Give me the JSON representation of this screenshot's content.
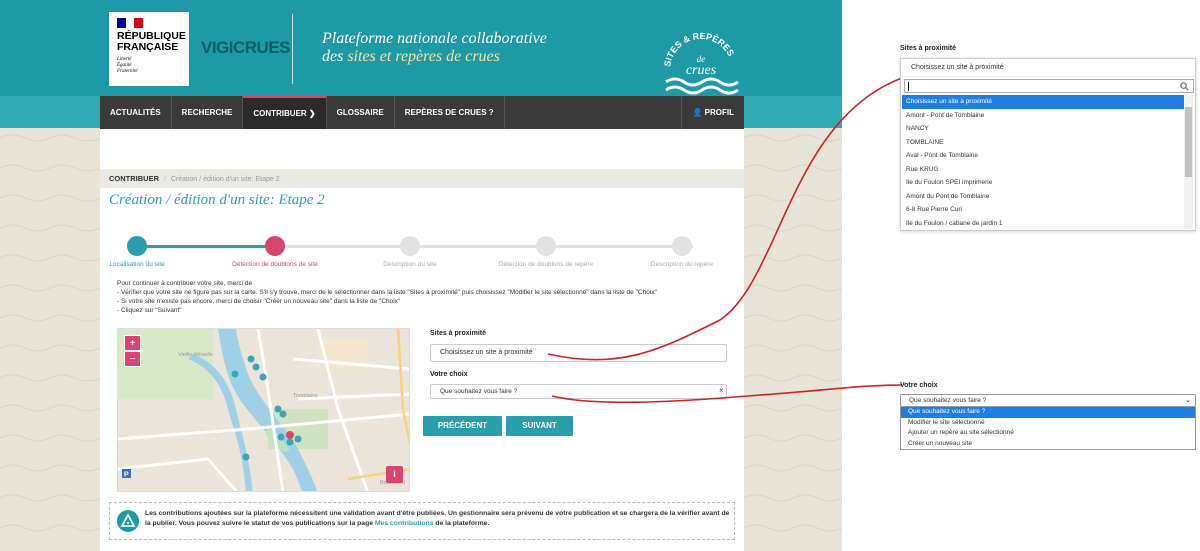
{
  "header": {
    "rf_title": [
      "RÉPUBLIQUE",
      "FRANÇAISE"
    ],
    "rf_motto": [
      "Liberté",
      "Égalité",
      "Fraternité"
    ],
    "vigicrues": "VIGICRUES",
    "platform_title_line1": "Plateforme nationale collaborative",
    "platform_title_line2_prefix": "des ",
    "platform_title_line2_highlight": "sites et repères de crues",
    "logo_text": [
      "SITES & REPÈRES",
      "de",
      "crues"
    ],
    "colors": {
      "teal": "#1d9aa6",
      "pink": "#d8456e",
      "navbar": "#3a3a3a"
    }
  },
  "nav": {
    "items": [
      "ACTUALITÉS",
      "RECHERCHE",
      "CONTRIBUER",
      "GLOSSAIRE",
      "REPÈRES DE CRUES ?"
    ],
    "profile": "PROFIL"
  },
  "breadcrumb": {
    "root": "CONTRIBUER",
    "sep": "/",
    "current": "Création / édition d'un site: Etape 2"
  },
  "page_title": "Création / édition d'un site: Etape 2",
  "stepper": {
    "steps": [
      {
        "label": "Localisation du site",
        "state": "done"
      },
      {
        "label": "Détection de doublons de site",
        "state": "current"
      },
      {
        "label": "Description du site",
        "state": "todo"
      },
      {
        "label": "Détection de doublons de repère",
        "state": "todo"
      },
      {
        "label": "Description du repère",
        "state": "todo"
      }
    ]
  },
  "instructions": [
    "Pour continuer à contribuer votre site, merci de",
    "- Vérifier que votre site ne figure pas sur la carte. S'il s'y trouve, merci de le sélectionner dans la liste \"Sites à proximité\" puis choisissez \"Modifier le site sélectionné\" dans la liste de \"Choix\"",
    "- Si votre site n'existe pas encore, merci de choisir \"Créer un nouveau site\" dans la liste de \"Choix\"",
    "- Cliquez sur \"Suivant\""
  ],
  "map": {
    "zoom_in": "+",
    "zoom_out": "−",
    "info": "i",
    "labels": [
      "Vieille Moselle",
      "Tomblaine",
      "Boulevard"
    ]
  },
  "form": {
    "sites_label": "Sites à proximité",
    "sites_value": "Choisissez un site à proximité",
    "choix_label": "Votre choix",
    "choix_value": "Que souhaitez vous faire ?",
    "clear": "×",
    "prev_button": "PRÉCÉDENT",
    "next_button": "SUIVANT"
  },
  "notice": {
    "text_before": "Les contributions ajoutées sur la plateforme nécessitent une validation avant d'être publiées. Un gestionnaire sera prévenu de votre publication et se chargera de la vérifier avant de la publier. Vous pouvez suivre le statut de vos publications sur la page ",
    "link": "Mes contributions",
    "text_after": " de la plateforme."
  },
  "dropdown_sites": {
    "label": "Sites à proximité",
    "placeholder": "Choisissez un site à proximité",
    "options": [
      "Choisissez un site à proximité",
      "Amont - Pont de Tomblaine",
      "NANCY",
      "TOMBLAINE",
      "Aval - Pont de Tomblaine",
      "Rue KRUG",
      "Ile du Foulon SPEI imprimerie",
      "Amont du Pont de Tomblaine",
      "6-8 Rue Pierre Curi",
      "Ile du Foulon / cabane de jardin 1"
    ],
    "selected_index": 0,
    "search_icon": "search-icon"
  },
  "dropdown_choix": {
    "label": "Votre choix",
    "value": "Que souhaitez vous faire ?",
    "options": [
      "Que souhaitez vous faire ?",
      "Modifier le site sélectionné",
      "Ajouter un repère au site sélectionné",
      "Créer un nouveau site"
    ],
    "selected_index": 0
  }
}
